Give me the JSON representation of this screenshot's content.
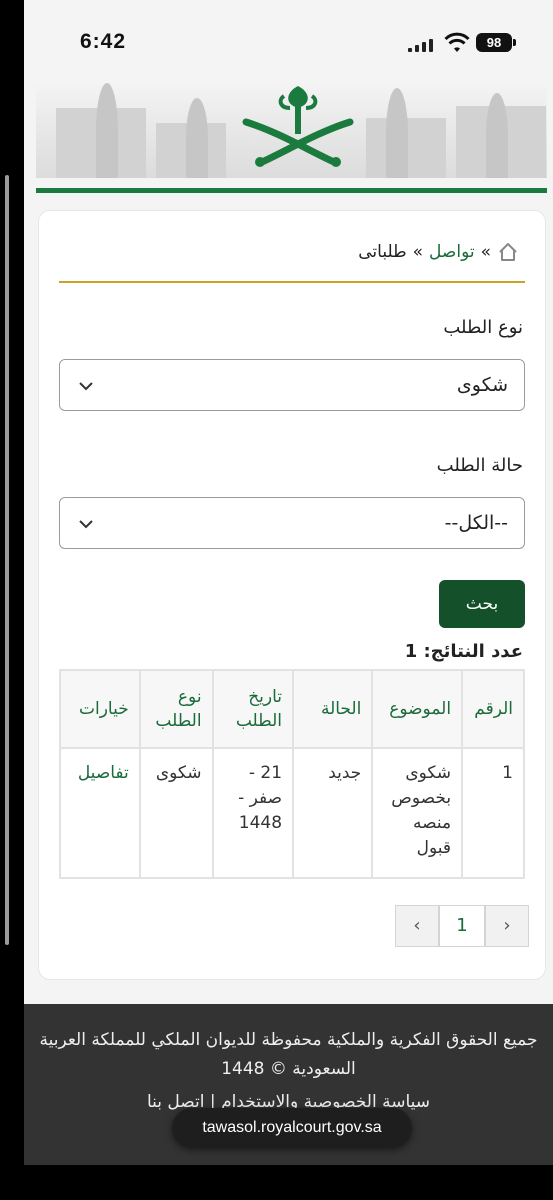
{
  "status_bar": {
    "time": "6:42",
    "battery": "98"
  },
  "breadcrumb": {
    "sep1": "»",
    "link": "تواصل",
    "sep2": "»",
    "current": "طلباتى"
  },
  "filters": {
    "type_label": "نوع الطلب",
    "type_value": "شكوى",
    "status_label": "حالة الطلب",
    "status_value": "--الكل--",
    "search_button": "بحث"
  },
  "results_count": "عدد النتائج: 1",
  "table": {
    "headers": [
      "الرقم",
      "الموضوع",
      "الحالة",
      "تاريخ الطلب",
      "نوع الطلب",
      "خيارات"
    ],
    "rows": [
      {
        "number": "1",
        "subject": "شكوى بخصوص منصه قبول",
        "status": "جديد",
        "date": "21 - صفر - 1448",
        "type": "شكوى",
        "action": "تفاصيل"
      }
    ]
  },
  "pagination": {
    "prev": "‹",
    "page": "1",
    "next": "›"
  },
  "footer": {
    "copyright": "جميع الحقوق الفكرية والملكية محفوظة للديوان الملكي للمملكة العربية السعودية © 1448",
    "privacy_link": "سياسة الخصوصية والاستخدام",
    "separator": "|",
    "contact_link": "اتصل بنا"
  },
  "url": "tawasol.royalcourt.gov.sa",
  "colors": {
    "primary_green": "#14502a",
    "link_green": "#1b6b3a",
    "gold": "#c9a227",
    "footer_bg": "#333333"
  }
}
